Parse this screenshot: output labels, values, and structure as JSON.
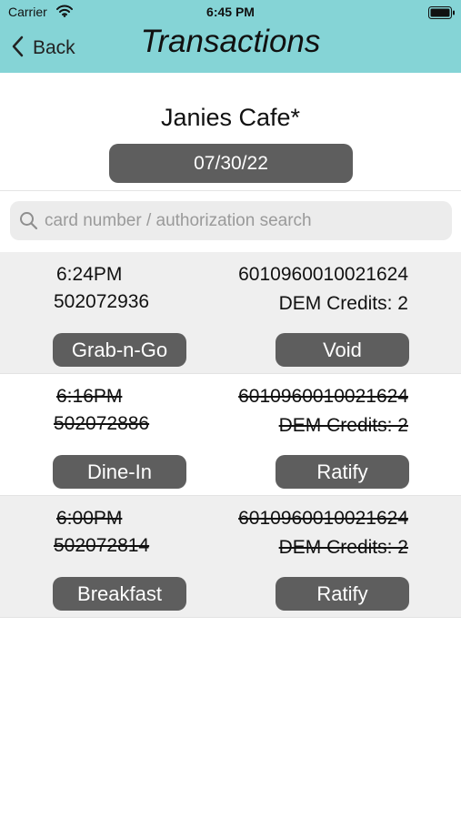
{
  "status_bar": {
    "carrier": "Carrier",
    "time": "6:45 PM"
  },
  "nav": {
    "back_label": "Back",
    "title": "Transactions"
  },
  "venue": {
    "name": "Janies Cafe*",
    "date": "07/30/22"
  },
  "search": {
    "placeholder": "card number / authorization search",
    "value": ""
  },
  "transactions": [
    {
      "time": "6:24PM",
      "authorization": "502072936",
      "card_number": "6010960010021624",
      "credits": "DEM Credits: 2",
      "meal_type": "Grab-n-Go",
      "action": "Void",
      "struck": false
    },
    {
      "time": "6:16PM",
      "authorization": "502072886",
      "card_number": "6010960010021624",
      "credits": "DEM Credits: 2",
      "meal_type": "Dine-In",
      "action": "Ratify",
      "struck": true
    },
    {
      "time": "6:00PM",
      "authorization": "502072814",
      "card_number": "6010960010021624",
      "credits": "DEM Credits: 2",
      "meal_type": "Breakfast",
      "action": "Ratify",
      "struck": true
    }
  ],
  "colors": {
    "header_bg": "#85d4d6",
    "button_bg": "#5e5e5e",
    "row_shade": "#efefef"
  },
  "icons": {
    "back": "chevron-left-icon",
    "search": "search-icon",
    "wifi": "wifi-icon",
    "battery": "battery-icon"
  }
}
